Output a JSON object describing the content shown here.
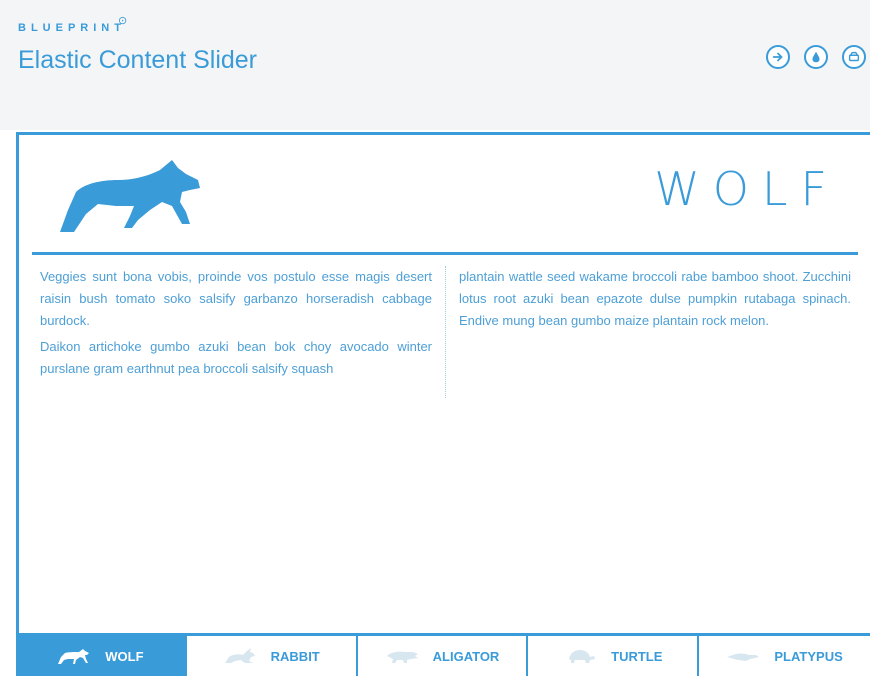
{
  "brand": {
    "name": "BLUEPRINT",
    "mark": "⊙"
  },
  "page": {
    "title": "Elastic Content Slider"
  },
  "header_buttons": [
    {
      "icon": "arrow-right-circle-icon"
    },
    {
      "icon": "drop-circle-icon"
    },
    {
      "icon": "archive-circle-icon"
    }
  ],
  "slide": {
    "title": "WOLF",
    "paragraphs_left": [
      "Veggies sunt bona vobis, proinde vos postulo esse magis desert raisin bush tomato soko salsify garbanzo horseradish cabbage burdock.",
      "Daikon artichoke gumbo azuki bean bok choy avocado winter purslane gram earthnut pea broccoli salsify squash"
    ],
    "paragraphs_right": [
      "plantain wattle seed wakame broccoli rabe bamboo shoot. Zucchini lotus root azuki bean epazote dulse pumpkin rutabaga spinach. Endive mung bean gumbo maize plantain rock melon."
    ]
  },
  "tabs": [
    {
      "label": "WOLF",
      "icon": "wolf-icon",
      "active": true
    },
    {
      "label": "RABBIT",
      "icon": "rabbit-icon",
      "active": false
    },
    {
      "label": "ALIGATOR",
      "icon": "alligator-icon",
      "active": false
    },
    {
      "label": "TURTLE",
      "icon": "turtle-icon",
      "active": false
    },
    {
      "label": "PLATYPUS",
      "icon": "platypus-icon",
      "active": false
    }
  ],
  "colors": {
    "accent": "#3a9bd9",
    "muted_icon": "#d8e6f0"
  }
}
